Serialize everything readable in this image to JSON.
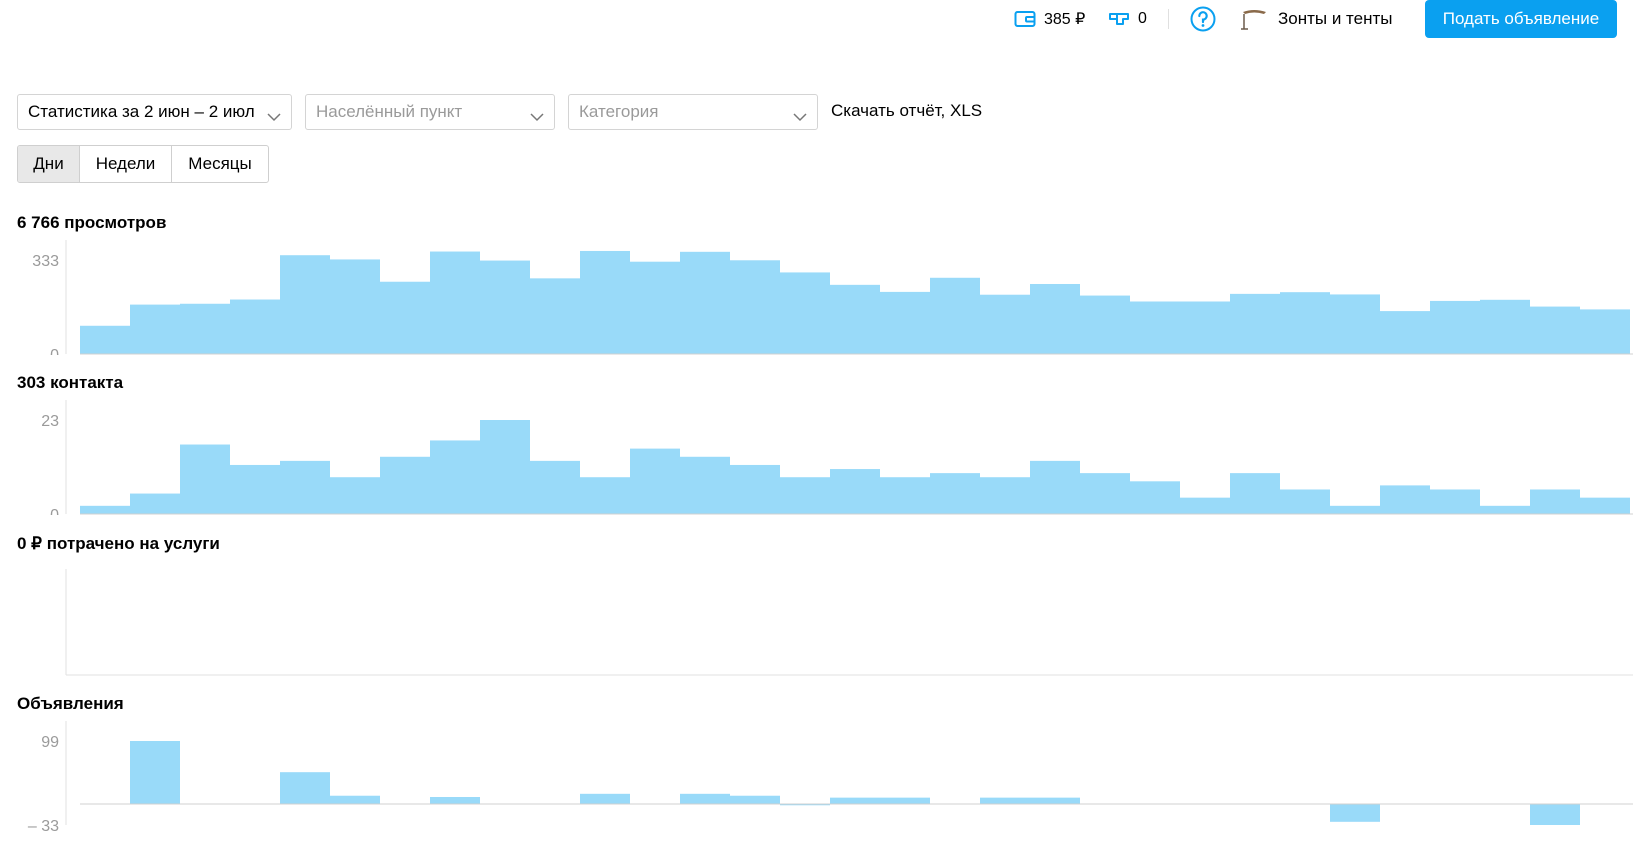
{
  "header": {
    "wallet": {
      "icon": "wallet-icon",
      "value": "385 ₽"
    },
    "bonus": {
      "icon": "bonus-icon",
      "value": "0"
    },
    "help": {
      "icon": "help-icon"
    },
    "shop": {
      "icon": "umbrella-icon",
      "name": "Зонты и тенты"
    },
    "post_button": "Подать объявление"
  },
  "filters": {
    "period": "Статистика за 2 июн – 2 июл",
    "city_placeholder": "Населённый пункт",
    "category_placeholder": "Категория",
    "download": "Скачать отчёт, XLS"
  },
  "granularity": {
    "options": [
      "Дни",
      "Недели",
      "Месяцы"
    ],
    "selected": "Дни"
  },
  "colors": {
    "accent": "#0aa0f0",
    "bar": "#99daf9"
  },
  "chart_data": [
    {
      "type": "bar",
      "title": "6 766 просмотров",
      "yticks": [
        333,
        0
      ],
      "ylim": [
        0,
        333
      ],
      "values": [
        100,
        175,
        178,
        193,
        350,
        335,
        256,
        363,
        331,
        268,
        365,
        327,
        362,
        332,
        289,
        245,
        220,
        270,
        210,
        248,
        207,
        186,
        186,
        213,
        219,
        211,
        152,
        188,
        192,
        168,
        158
      ]
    },
    {
      "type": "bar",
      "title": "303 контакта",
      "yticks": [
        23,
        0
      ],
      "ylim": [
        0,
        23
      ],
      "values": [
        2,
        5,
        17,
        12,
        13,
        9,
        14,
        18,
        23,
        13,
        9,
        16,
        14,
        12,
        9,
        11,
        9,
        10,
        9,
        13,
        10,
        8,
        4,
        10,
        6,
        2,
        7,
        6,
        2,
        6,
        4
      ]
    },
    {
      "type": "bar",
      "title": "0 ₽ потрачено на услуги",
      "yticks": [],
      "values": []
    },
    {
      "type": "bar",
      "title": "Объявления",
      "yticks": [
        99,
        -33
      ],
      "ylim": [
        -33,
        99
      ],
      "values": [
        0,
        99,
        0,
        0,
        50,
        13,
        0,
        11,
        0,
        0,
        16,
        0,
        16,
        13,
        -2,
        10,
        10,
        0,
        10,
        10,
        0,
        0,
        0,
        0,
        0,
        -28,
        0,
        0,
        0,
        -33,
        0
      ]
    }
  ]
}
